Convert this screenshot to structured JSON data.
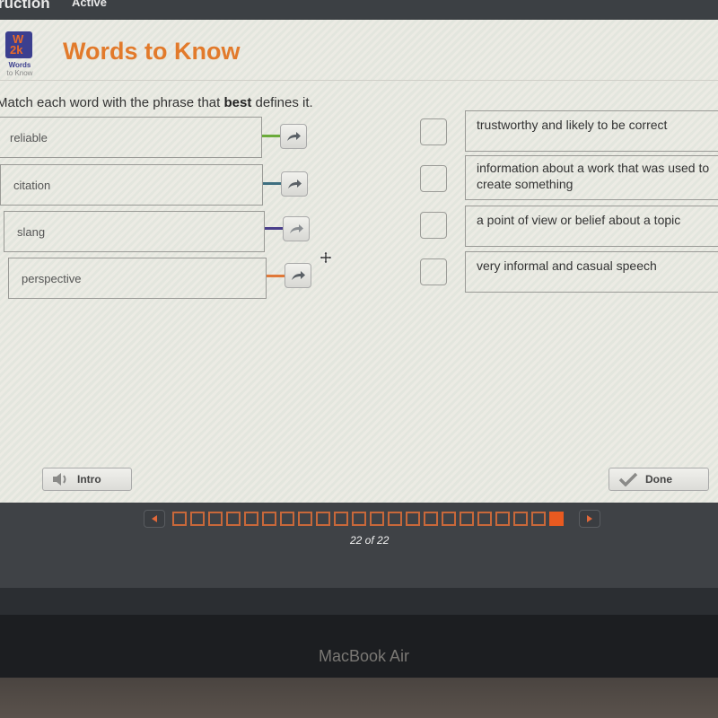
{
  "topbar": {
    "left_text": "ruction",
    "status": "Active"
  },
  "header": {
    "logo_top": "W",
    "logo_bottom": "2k",
    "logo_caption_1": "Words",
    "logo_caption_2": "to Know",
    "title": "Words to Know"
  },
  "instructions": {
    "before": "Match each word with the phrase that ",
    "bold": "best",
    "after": " defines it."
  },
  "words": [
    {
      "label": "reliable",
      "color": "#6bab3a"
    },
    {
      "label": "citation",
      "color": "#3e6f80"
    },
    {
      "label": "slang",
      "color": "#4a3f8a"
    },
    {
      "label": "perspective",
      "color": "#e07838"
    }
  ],
  "definitions": [
    {
      "text": "trustworthy and likely to be correct",
      "checked": false
    },
    {
      "text": "information about a work that was used to create something",
      "checked": false
    },
    {
      "text": "a point of view or belief about a topic",
      "checked": false
    },
    {
      "text": "very informal and casual speech",
      "checked": false
    }
  ],
  "buttons": {
    "intro": "Intro",
    "done": "Done"
  },
  "navigation": {
    "current": 22,
    "total": 22,
    "counter_text": "22 of 22"
  },
  "bezel": {
    "label": "MacBook Air"
  },
  "colors": {
    "accent": "#e27a2b",
    "nav_active": "#e85a20"
  }
}
